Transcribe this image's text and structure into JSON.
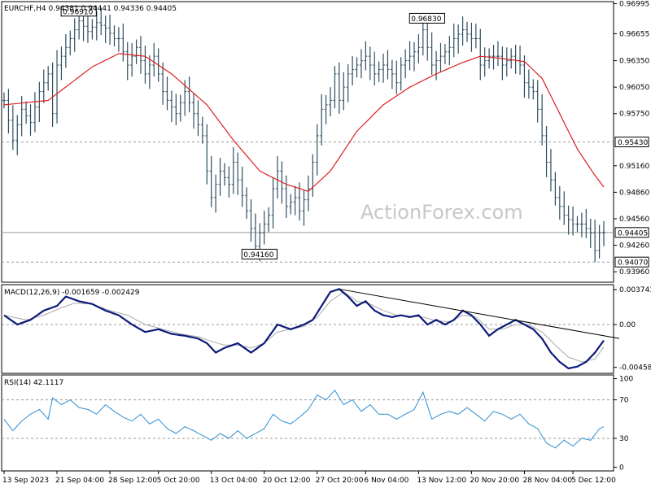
{
  "header": {
    "main": "EURCHF,H4  0.94381 0.94441 0.94336 0.94405",
    "macd": "MACD(12,26,9) -0.001659 -0.002429",
    "rsi": "RSI(14) 42.1117"
  },
  "watermark": "ActionForex.com",
  "colors": {
    "candle": "#2f4f5f",
    "ma": "#dd1f1f",
    "macd_line": "#0d1a7a",
    "signal_line": "#a9a9a9",
    "rsi": "#2f8fd0",
    "trendline": "#000000",
    "grid": "#9a9a9a"
  },
  "chart_data": [
    {
      "type": "candlestick",
      "symbol": "EURCHF",
      "timeframe": "H4",
      "ylim": [
        0.9386,
        0.97
      ],
      "y_ticks": [
        "0.96995",
        "0.96655",
        "0.96350",
        "0.96050",
        "0.95750",
        "0.95160",
        "0.94860",
        "0.94560",
        "0.94260",
        "0.93960"
      ],
      "y_tick_values": [
        0.96995,
        0.96655,
        0.9635,
        0.9605,
        0.9575,
        0.9516,
        0.9486,
        0.9456,
        0.9426,
        0.9396
      ],
      "level_labels": [
        {
          "text": "0.95430",
          "value": 0.9543,
          "dashed": true
        },
        {
          "text": "0.94405",
          "value": 0.94405,
          "dashed": false
        },
        {
          "text": "0.94070",
          "value": 0.9407,
          "dashed": true
        }
      ],
      "annotations": [
        {
          "text": "0.96910",
          "x": 17,
          "value": 0.9691
        },
        {
          "text": "0.96830",
          "x": 96,
          "value": 0.9683
        },
        {
          "text": "0.94160",
          "x": 58,
          "value": 0.9416
        }
      ],
      "close_key": [
        [
          0,
          0.959
        ],
        [
          2,
          0.9545
        ],
        [
          4,
          0.958
        ],
        [
          6,
          0.9565
        ],
        [
          8,
          0.96
        ],
        [
          10,
          0.962
        ],
        [
          11,
          0.9575
        ],
        [
          12,
          0.963
        ],
        [
          14,
          0.965
        ],
        [
          15,
          0.966
        ],
        [
          17,
          0.968
        ],
        [
          19,
          0.9668
        ],
        [
          21,
          0.9678
        ],
        [
          23,
          0.9672
        ],
        [
          25,
          0.966
        ],
        [
          26,
          0.966
        ],
        [
          28,
          0.963
        ],
        [
          30,
          0.965
        ],
        [
          32,
          0.962
        ],
        [
          34,
          0.964
        ],
        [
          36,
          0.96
        ],
        [
          37,
          0.959
        ],
        [
          39,
          0.9575
        ],
        [
          41,
          0.96
        ],
        [
          43,
          0.9575
        ],
        [
          45,
          0.955
        ],
        [
          46,
          0.951
        ],
        [
          47,
          0.948
        ],
        [
          49,
          0.951
        ],
        [
          51,
          0.9495
        ],
        [
          52,
          0.952
        ],
        [
          53,
          0.95
        ],
        [
          55,
          0.9465
        ],
        [
          56,
          0.9445
        ],
        [
          57,
          0.9425
        ],
        [
          58,
          0.944
        ],
        [
          60,
          0.946
        ],
        [
          61,
          0.949
        ],
        [
          62,
          0.951
        ],
        [
          64,
          0.947
        ],
        [
          66,
          0.948
        ],
        [
          67,
          0.9465
        ],
        [
          69,
          0.949
        ],
        [
          70,
          0.952
        ],
        [
          71,
          0.955
        ],
        [
          72,
          0.958
        ],
        [
          74,
          0.959
        ],
        [
          75,
          0.962
        ],
        [
          76,
          0.959
        ],
        [
          78,
          0.962
        ],
        [
          80,
          0.963
        ],
        [
          82,
          0.964
        ],
        [
          84,
          0.962
        ],
        [
          86,
          0.963
        ],
        [
          88,
          0.962
        ],
        [
          89,
          0.961
        ],
        [
          90,
          0.963
        ],
        [
          92,
          0.964
        ],
        [
          94,
          0.965
        ],
        [
          95,
          0.967
        ],
        [
          97,
          0.963
        ],
        [
          99,
          0.964
        ],
        [
          101,
          0.965
        ],
        [
          102,
          0.966
        ],
        [
          104,
          0.967
        ],
        [
          106,
          0.966
        ],
        [
          107,
          0.966
        ],
        [
          108,
          0.963
        ],
        [
          110,
          0.964
        ],
        [
          112,
          0.964
        ],
        [
          113,
          0.963
        ],
        [
          115,
          0.964
        ],
        [
          117,
          0.963
        ],
        [
          118,
          0.961
        ],
        [
          120,
          0.96
        ],
        [
          121,
          0.958
        ],
        [
          122,
          0.955
        ],
        [
          123,
          0.952
        ],
        [
          124,
          0.95
        ],
        [
          125,
          0.948
        ],
        [
          127,
          0.946
        ],
        [
          129,
          0.945
        ],
        [
          131,
          0.945
        ],
        [
          133,
          0.944
        ],
        [
          134,
          0.942
        ],
        [
          135,
          0.944
        ],
        [
          136,
          0.94405
        ]
      ],
      "ma_key": [
        [
          0,
          0.9585
        ],
        [
          10,
          0.959
        ],
        [
          20,
          0.9628
        ],
        [
          26,
          0.9643
        ],
        [
          32,
          0.964
        ],
        [
          38,
          0.962
        ],
        [
          46,
          0.9585
        ],
        [
          52,
          0.9545
        ],
        [
          58,
          0.951
        ],
        [
          64,
          0.9495
        ],
        [
          69,
          0.9487
        ],
        [
          74,
          0.951
        ],
        [
          80,
          0.9555
        ],
        [
          86,
          0.9585
        ],
        [
          92,
          0.9605
        ],
        [
          98,
          0.962
        ],
        [
          104,
          0.9633
        ],
        [
          108,
          0.964
        ],
        [
          112,
          0.9638
        ],
        [
          118,
          0.9634
        ],
        [
          122,
          0.9615
        ],
        [
          126,
          0.9575
        ],
        [
          130,
          0.9535
        ],
        [
          134,
          0.9505
        ],
        [
          136,
          0.9492
        ]
      ]
    },
    {
      "type": "line",
      "name": "MACD(12,26,9)",
      "ylim": [
        -0.00505,
        0.0041
      ],
      "y_ticks": [
        "0.003743",
        "0.00",
        "-0.004585"
      ],
      "y_tick_values": [
        0.003743,
        0.0,
        -0.004585
      ],
      "trendline": [
        [
          76,
          0.0038
        ],
        [
          136,
          -0.0012
        ]
      ],
      "macd_key": [
        [
          0,
          0.001
        ],
        [
          3,
          0.0
        ],
        [
          6,
          0.0005
        ],
        [
          9,
          0.0015
        ],
        [
          12,
          0.002
        ],
        [
          14,
          0.003
        ],
        [
          17,
          0.0025
        ],
        [
          20,
          0.0022
        ],
        [
          23,
          0.0015
        ],
        [
          26,
          0.001
        ],
        [
          29,
          0.0
        ],
        [
          32,
          -0.0008
        ],
        [
          35,
          -0.0005
        ],
        [
          38,
          -0.001
        ],
        [
          41,
          -0.0012
        ],
        [
          44,
          -0.0015
        ],
        [
          46,
          -0.002
        ],
        [
          48,
          -0.003
        ],
        [
          50,
          -0.0025
        ],
        [
          53,
          -0.002
        ],
        [
          56,
          -0.003
        ],
        [
          59,
          -0.002
        ],
        [
          62,
          0.0
        ],
        [
          65,
          -0.0005
        ],
        [
          68,
          0.0
        ],
        [
          70,
          0.0005
        ],
        [
          72,
          0.002
        ],
        [
          74,
          0.0035
        ],
        [
          76,
          0.0038
        ],
        [
          78,
          0.003
        ],
        [
          80,
          0.002
        ],
        [
          82,
          0.0025
        ],
        [
          84,
          0.0015
        ],
        [
          86,
          0.001
        ],
        [
          88,
          0.0008
        ],
        [
          90,
          0.001
        ],
        [
          92,
          0.0008
        ],
        [
          94,
          0.001
        ],
        [
          96,
          0.0
        ],
        [
          98,
          0.0005
        ],
        [
          100,
          0.0
        ],
        [
          102,
          0.0005
        ],
        [
          104,
          0.0015
        ],
        [
          106,
          0.001
        ],
        [
          108,
          0.0
        ],
        [
          110,
          -0.0012
        ],
        [
          112,
          -0.0005
        ],
        [
          114,
          0.0
        ],
        [
          116,
          0.0005
        ],
        [
          118,
          0.0
        ],
        [
          120,
          -0.0005
        ],
        [
          122,
          -0.0015
        ],
        [
          124,
          -0.003
        ],
        [
          126,
          -0.004
        ],
        [
          128,
          -0.0047
        ],
        [
          130,
          -0.0045
        ],
        [
          132,
          -0.004
        ],
        [
          134,
          -0.003
        ],
        [
          136,
          -0.0017
        ]
      ],
      "signal_key": [
        [
          0,
          0.001
        ],
        [
          5,
          0.0005
        ],
        [
          9,
          0.001
        ],
        [
          13,
          0.0018
        ],
        [
          16,
          0.0023
        ],
        [
          20,
          0.0022
        ],
        [
          24,
          0.0015
        ],
        [
          28,
          0.001
        ],
        [
          32,
          0.0
        ],
        [
          36,
          -0.0005
        ],
        [
          40,
          -0.001
        ],
        [
          44,
          -0.0013
        ],
        [
          47,
          -0.0018
        ],
        [
          50,
          -0.0022
        ],
        [
          53,
          -0.0022
        ],
        [
          56,
          -0.0025
        ],
        [
          59,
          -0.002
        ],
        [
          62,
          -0.0008
        ],
        [
          65,
          -0.0005
        ],
        [
          68,
          -0.0002
        ],
        [
          71,
          0.0008
        ],
        [
          74,
          0.0025
        ],
        [
          77,
          0.0035
        ],
        [
          80,
          0.0025
        ],
        [
          83,
          0.0022
        ],
        [
          86,
          0.0015
        ],
        [
          89,
          0.001
        ],
        [
          92,
          0.0009
        ],
        [
          95,
          0.0008
        ],
        [
          98,
          0.0004
        ],
        [
          101,
          0.0003
        ],
        [
          104,
          0.001
        ],
        [
          107,
          0.0008
        ],
        [
          110,
          -0.0005
        ],
        [
          113,
          -0.0005
        ],
        [
          116,
          0.0
        ],
        [
          119,
          0.0
        ],
        [
          122,
          -0.0008
        ],
        [
          125,
          -0.0022
        ],
        [
          128,
          -0.0035
        ],
        [
          131,
          -0.004
        ],
        [
          134,
          -0.0037
        ],
        [
          136,
          -0.0024
        ]
      ]
    },
    {
      "type": "line",
      "name": "RSI(14)",
      "ylim": [
        -3,
        95
      ],
      "y_ticks": [
        "100",
        "70",
        "30",
        "0"
      ],
      "y_tick_values": [
        92,
        70,
        30,
        0
      ],
      "dashed_levels": [
        70,
        30
      ],
      "rsi_key": [
        [
          0,
          50
        ],
        [
          2,
          38
        ],
        [
          4,
          48
        ],
        [
          6,
          55
        ],
        [
          8,
          60
        ],
        [
          10,
          50
        ],
        [
          11,
          72
        ],
        [
          13,
          65
        ],
        [
          15,
          70
        ],
        [
          17,
          62
        ],
        [
          19,
          60
        ],
        [
          21,
          55
        ],
        [
          23,
          65
        ],
        [
          25,
          58
        ],
        [
          27,
          52
        ],
        [
          29,
          48
        ],
        [
          31,
          55
        ],
        [
          33,
          45
        ],
        [
          35,
          50
        ],
        [
          37,
          40
        ],
        [
          39,
          35
        ],
        [
          41,
          42
        ],
        [
          43,
          38
        ],
        [
          45,
          33
        ],
        [
          47,
          28
        ],
        [
          49,
          35
        ],
        [
          51,
          30
        ],
        [
          53,
          38
        ],
        [
          55,
          30
        ],
        [
          57,
          35
        ],
        [
          59,
          40
        ],
        [
          61,
          55
        ],
        [
          63,
          48
        ],
        [
          65,
          45
        ],
        [
          67,
          52
        ],
        [
          69,
          60
        ],
        [
          71,
          75
        ],
        [
          73,
          70
        ],
        [
          75,
          80
        ],
        [
          77,
          65
        ],
        [
          79,
          70
        ],
        [
          81,
          58
        ],
        [
          83,
          65
        ],
        [
          85,
          55
        ],
        [
          87,
          55
        ],
        [
          89,
          50
        ],
        [
          91,
          55
        ],
        [
          93,
          60
        ],
        [
          95,
          78
        ],
        [
          97,
          50
        ],
        [
          99,
          55
        ],
        [
          101,
          58
        ],
        [
          103,
          55
        ],
        [
          105,
          62
        ],
        [
          107,
          55
        ],
        [
          109,
          48
        ],
        [
          111,
          58
        ],
        [
          113,
          55
        ],
        [
          115,
          50
        ],
        [
          117,
          55
        ],
        [
          119,
          45
        ],
        [
          121,
          40
        ],
        [
          123,
          25
        ],
        [
          125,
          20
        ],
        [
          127,
          28
        ],
        [
          129,
          22
        ],
        [
          131,
          30
        ],
        [
          133,
          28
        ],
        [
          134,
          34
        ],
        [
          135,
          40
        ],
        [
          136,
          42
        ]
      ]
    }
  ],
  "x_axis": {
    "labels": [
      "13 Sep 2023",
      "21 Sep 04:00",
      "28 Sep 12:00",
      "5 Oct 20:00",
      "13 Oct 04:00",
      "20 Oct 12:00",
      "27 Oct 20:00",
      "6 Nov 04:00",
      "13 Nov 12:00",
      "20 Nov 20:00",
      "28 Nov 04:00",
      "5 Dec 12:00"
    ],
    "positions": [
      0,
      12,
      24,
      35,
      47,
      59,
      71,
      82,
      94,
      106,
      118,
      129
    ],
    "count": 137
  }
}
